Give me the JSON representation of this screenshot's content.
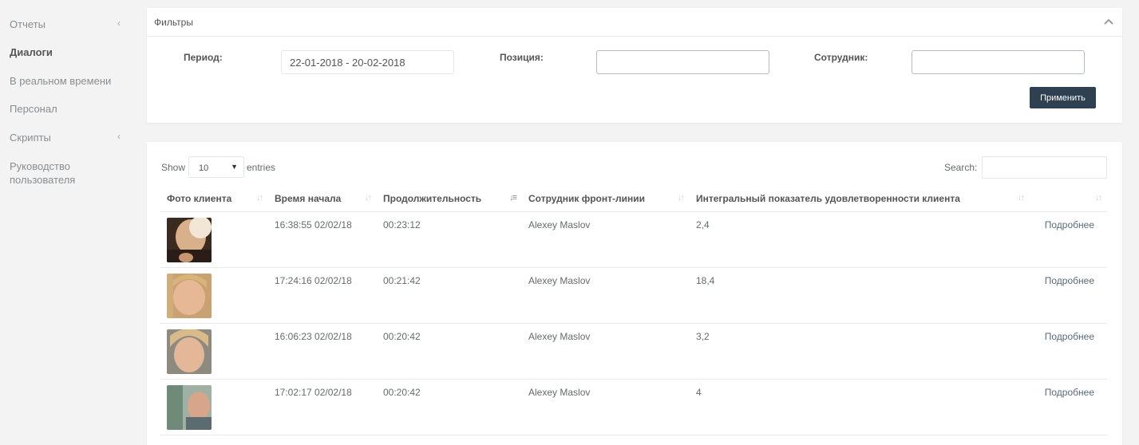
{
  "sidebar": {
    "items": [
      {
        "label": "Отчеты",
        "caret": "‹"
      },
      {
        "label": "Диалоги",
        "caret": ""
      },
      {
        "label": "В реальном времени",
        "caret": ""
      },
      {
        "label": "Персонал",
        "caret": ""
      },
      {
        "label": "Скрипты",
        "caret": "‹"
      },
      {
        "label": "Руководство пользователя",
        "caret": ""
      }
    ],
    "active": "Диалоги"
  },
  "filters": {
    "title": "Фильтры",
    "collapse_icon": "chevron-up-icon",
    "period_label": "Период:",
    "period_value": "22-01-2018 - 20-02-2018",
    "position_label": "Позиция:",
    "position_value": "",
    "employee_label": "Сотрудник:",
    "employee_value": "",
    "apply_label": "Применить"
  },
  "table": {
    "show_label": "Show",
    "length_value": "10",
    "entries_label": "entries",
    "search_label": "Search:",
    "search_value": "",
    "columns": [
      "Фото клиента",
      "Время начала",
      "Продолжительность",
      "Сотрудник фронт-линии",
      "Интегральный показатель удовлетворенности клиента",
      ""
    ],
    "rows": [
      {
        "time": "16:38:55 02/02/18",
        "duration": "00:23:12",
        "employee": "Alexey Maslov",
        "score": "2,4",
        "link": "Подробнее"
      },
      {
        "time": "17:24:16 02/02/18",
        "duration": "00:21:42",
        "employee": "Alexey Maslov",
        "score": "18,4",
        "link": "Подробнее"
      },
      {
        "time": "16:06:23 02/02/18",
        "duration": "00:20:42",
        "employee": "Alexey Maslov",
        "score": "3,2",
        "link": "Подробнее"
      },
      {
        "time": "17:02:17 02/02/18",
        "duration": "00:20:42",
        "employee": "Alexey Maslov",
        "score": "4",
        "link": "Подробнее"
      }
    ]
  },
  "colors": {
    "sidebar_bg": "#f3f3f4",
    "button_bg": "#2f4050",
    "panel_bg": "#ffffff"
  }
}
